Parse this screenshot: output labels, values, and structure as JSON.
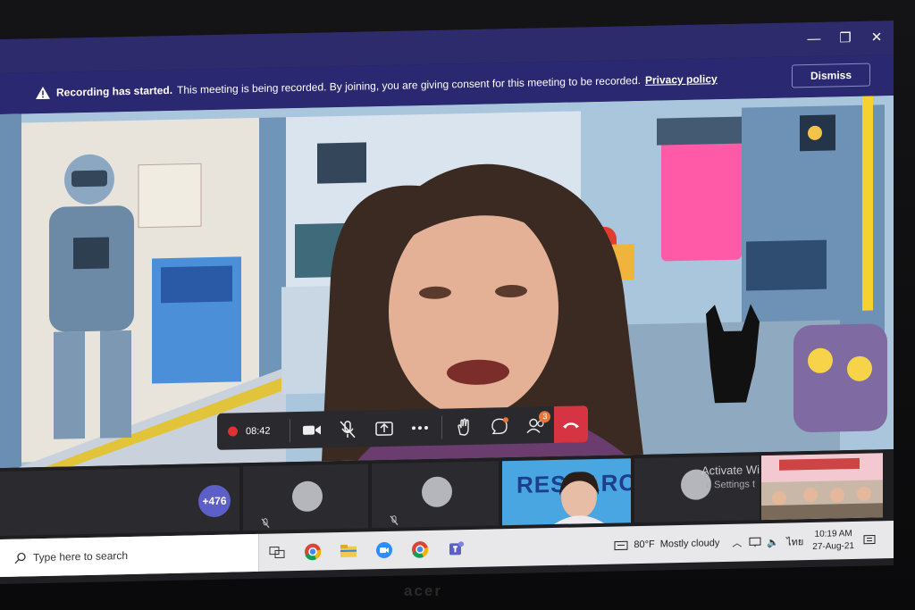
{
  "window": {
    "minimize": "—",
    "restore": "❐",
    "close": "✕"
  },
  "banner": {
    "bold": "Recording has started.",
    "message": "This meeting is being recorded. By joining, you are giving consent for this meeting to be recorded.",
    "policy_link": "Privacy policy",
    "dismiss_label": "Dismiss"
  },
  "toolbar": {
    "timer": "08:42",
    "people_badge": "3",
    "buttons": [
      "camera-icon",
      "mic-off-icon",
      "share-icon",
      "more-icon",
      "raise-hand-icon",
      "chat-icon",
      "people-icon",
      "hang-up-icon"
    ]
  },
  "strip": {
    "more_count": "+476",
    "shared_title": "RESEARCH",
    "activate_title": "Activate Wi",
    "activate_sub": "o Settings t"
  },
  "taskbar": {
    "search_placeholder": "Type here to search",
    "apps": [
      "task-view-icon",
      "chrome-icon",
      "file-explorer-icon",
      "zoom-icon",
      "chrome-icon",
      "teams-icon"
    ],
    "weather_temp": "80°F",
    "weather_text": "Mostly cloudy",
    "language": "ไทย",
    "time": "10:19 AM",
    "date": "27-Aug-21"
  },
  "monitor_brand": "acer",
  "colors": {
    "teams_purple": "#2d2b6b",
    "hangup_red": "#d73443",
    "accent": "#5b5fc7"
  }
}
